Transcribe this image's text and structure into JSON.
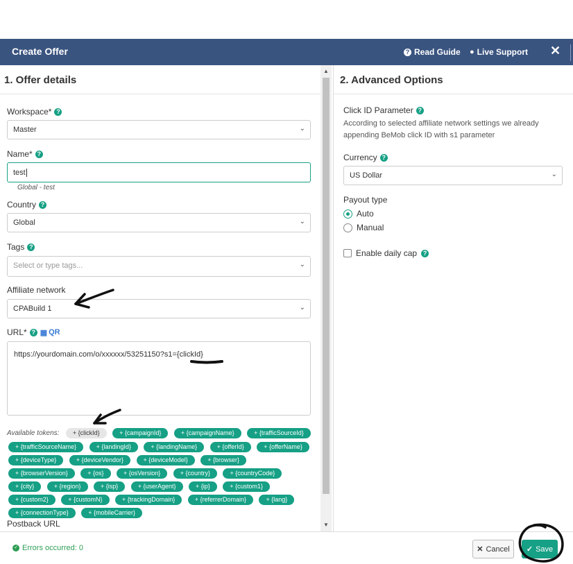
{
  "header": {
    "title": "Create Offer",
    "read_guide": "Read Guide",
    "live_support": "Live Support",
    "bg_color": "#3a5480"
  },
  "left": {
    "section_title": "1. Offer details",
    "workspace": {
      "label": "Workspace*",
      "value": "Master"
    },
    "name": {
      "label": "Name*",
      "value": "test",
      "hint": "Global - test"
    },
    "country": {
      "label": "Country",
      "value": "Global"
    },
    "tags": {
      "label": "Tags",
      "placeholder": "Select or type tags..."
    },
    "affiliate": {
      "label": "Affiliate network",
      "value": "CPABuild 1"
    },
    "url": {
      "label": "URL*",
      "qr": "QR",
      "value_prefix": "https://yourdomain.com/o/xxxxxx/53251150?s1=",
      "value_token": "{clickId}"
    },
    "tokens_label": "Available tokens:",
    "tokens": [
      "+ {clickId}",
      "+ {campaignId}",
      "+ {campaignName}",
      "+ {trafficSourceId}",
      "+ {trafficSourceName}",
      "+ {landingId}",
      "+ {landingName}",
      "+ {offerId}",
      "+ {offerName}",
      "+ {deviceType}",
      "+ {deviceVendor}",
      "+ {deviceModel}",
      "+ {browser}",
      "+ {browserVersion}",
      "+ {os}",
      "+ {osVersion}",
      "+ {country}",
      "+ {countryCode}",
      "+ {city}",
      "+ {region}",
      "+ {isp}",
      "+ {userAgent}",
      "+ {ip}",
      "+ {custom1}",
      "+ {custom2}",
      "+ {customN}",
      "+ {trackingDomain}",
      "+ {referrerDomain}",
      "+ {lang}",
      "+ {connectionType}",
      "+ {mobileCarrier}"
    ],
    "postback_label": "Postback URL"
  },
  "right": {
    "section_title": "2. Advanced Options",
    "click_id": {
      "label": "Click ID Parameter",
      "desc": "According to selected affiliate network settings we already appending BeMob click ID with s1 parameter"
    },
    "currency": {
      "label": "Currency",
      "value": "US Dollar"
    },
    "payout": {
      "label": "Payout type",
      "options": [
        "Auto",
        "Manual"
      ],
      "selected": "Auto"
    },
    "daily_cap": {
      "label": "Enable daily cap",
      "checked": false
    }
  },
  "footer": {
    "errors": "Errors occurred: 0",
    "cancel": "Cancel",
    "save": "Save"
  },
  "colors": {
    "accent": "#16a085",
    "success": "#2e9e55"
  }
}
